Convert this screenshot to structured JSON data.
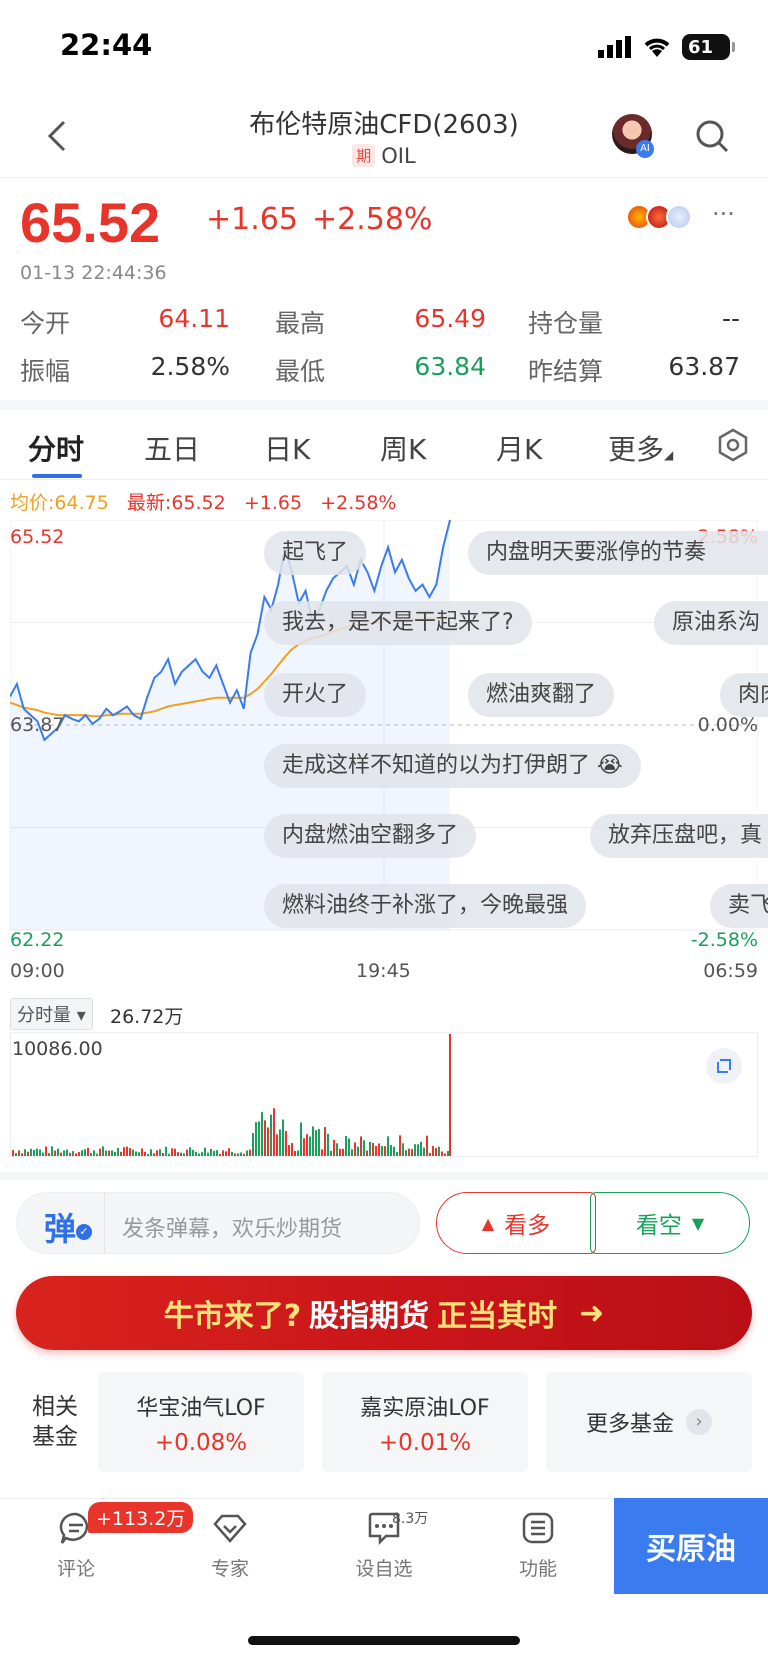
{
  "status_bar": {
    "time": "22:44",
    "battery": "61"
  },
  "header": {
    "title": "布伦特原油CFD(2603)",
    "badge": "期",
    "subtitle": "OIL"
  },
  "quote": {
    "price": "65.52",
    "change": "+1.65",
    "change_pct": "+2.58%",
    "timestamp": "01-13 22:44:36",
    "rows": [
      [
        {
          "label": "今开",
          "value": "64.11",
          "color": "#e8352c"
        },
        {
          "label": "最高",
          "value": "65.49",
          "color": "#e8352c"
        },
        {
          "label": "持仓量",
          "value": "--",
          "color": "#333"
        }
      ],
      [
        {
          "label": "振幅",
          "value": "2.58%",
          "color": "#333"
        },
        {
          "label": "最低",
          "value": "63.84",
          "color": "#19a05b"
        },
        {
          "label": "昨结算",
          "value": "63.87",
          "color": "#333"
        }
      ]
    ]
  },
  "tabs": [
    "分时",
    "五日",
    "日K",
    "周K",
    "月K",
    "更多"
  ],
  "chart_head": {
    "avg": "均价:64.75",
    "latest": "最新:65.52",
    "chg": "+1.65",
    "pct": "+2.58%"
  },
  "chart_data": {
    "type": "line",
    "title": "",
    "y_left_ticks": [
      "65.52",
      "63.87",
      "62.22"
    ],
    "y_right_ticks": [
      "2.58%",
      "0.00%",
      "-2.58%"
    ],
    "x_ticks": [
      "09:00",
      "19:45",
      "06:59"
    ],
    "ylim": [
      62.22,
      65.52
    ],
    "prev_close": 63.87,
    "series": [
      {
        "values": [
          64.1,
          64.2,
          64.0,
          63.95,
          63.9,
          63.75,
          63.8,
          63.85,
          63.95,
          63.92,
          63.9,
          63.95,
          63.88,
          63.92,
          64.0,
          63.95,
          63.98,
          64.02,
          63.95,
          63.92,
          64.1,
          64.25,
          64.3,
          64.4,
          64.2,
          64.3,
          64.35,
          64.4,
          64.3,
          64.25,
          64.35,
          64.2,
          64.05,
          64.15,
          64.0,
          64.45,
          64.6,
          64.9,
          64.8,
          65.0,
          65.3,
          65.1,
          64.85,
          64.95,
          64.7,
          64.8,
          64.95,
          65.05,
          65.1,
          65.15,
          65.0,
          65.2,
          65.1,
          64.95,
          65.15,
          65.3,
          65.1,
          65.2,
          65.05,
          64.95,
          65.0,
          64.9,
          65.0,
          65.3,
          65.52
        ]
      },
      {
        "values": [
          64.05,
          64.03,
          64.01,
          64.0,
          63.99,
          63.97,
          63.96,
          63.95,
          63.95,
          63.95,
          63.95,
          63.95,
          63.94,
          63.94,
          63.95,
          63.95,
          63.96,
          63.96,
          63.96,
          63.96,
          63.97,
          63.98,
          64.0,
          64.02,
          64.03,
          64.04,
          64.05,
          64.06,
          64.07,
          64.08,
          64.09,
          64.09,
          64.09,
          64.09,
          64.09,
          64.12,
          64.16,
          64.22,
          64.28,
          64.35,
          64.42,
          64.48,
          64.52,
          64.55,
          64.57,
          64.58,
          64.6,
          64.62,
          64.64,
          64.66,
          64.67,
          64.68,
          64.69,
          64.69,
          64.7,
          64.71,
          64.71,
          64.72,
          64.72,
          64.72,
          64.72,
          64.73,
          64.73,
          64.74,
          64.75
        ]
      }
    ],
    "colors": {
      "price": "#3a7bf0",
      "avg": "#f0a020"
    }
  },
  "danmaku": [
    "起飞了",
    "内盘明天要涨停的节奏",
    "我去，是不是干起来了?",
    "原油系沟",
    "开火了",
    "燃油爽翻了",
    "肉肉",
    "走成这样不知道的以为打伊朗了 😭",
    "内盘燃油空翻多了",
    "放弃压盘吧，真",
    "燃料油终于补涨了，今晚最强",
    "卖飞"
  ],
  "volume": {
    "selector": "分时量",
    "total": "26.72万",
    "max_label": "10086.00"
  },
  "input": {
    "icon": "弹",
    "placeholder": "发条弹幕，欢乐炒期货"
  },
  "sentiment": {
    "bull": "看多",
    "bear": "看空"
  },
  "banner": {
    "part1": "牛市来了?",
    "part2": "股指期货",
    "part3": "正当其时"
  },
  "funds": {
    "label": "相关基金",
    "items": [
      {
        "name": "华宝油气LOF",
        "chg": "+0.08%"
      },
      {
        "name": "嘉实原油LOF",
        "chg": "+0.01%"
      }
    ],
    "more": "更多基金"
  },
  "bottom_nav": {
    "comment": "评论",
    "comment_badge": "+113.2万",
    "expert": "专家",
    "watch": "设自选",
    "watch_count": "8.3万",
    "func": "功能",
    "buy": "买原油"
  }
}
